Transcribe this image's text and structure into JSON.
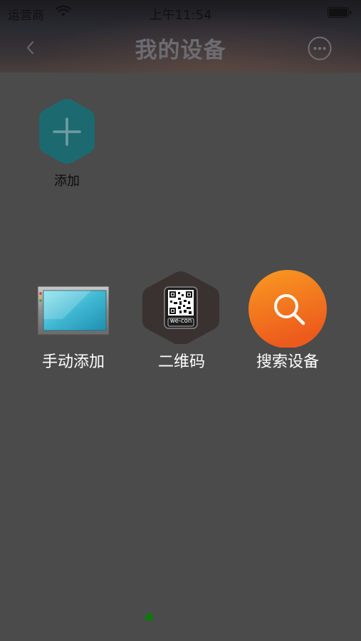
{
  "status_bar": {
    "carrier": "运营商",
    "time": "上午11:54"
  },
  "header": {
    "title": "我的设备",
    "back_icon": "chevron-left-icon",
    "more_icon": "more-circle-icon"
  },
  "add_tile": {
    "label": "添加",
    "icon": "plus-hexagon-icon",
    "color": "#1f6d73"
  },
  "options": [
    {
      "label": "手动添加",
      "icon": "hmi-screen-icon"
    },
    {
      "label": "二维码",
      "icon": "qr-code-icon",
      "brand_text": "we-con"
    },
    {
      "label": "搜索设备",
      "icon": "search-icon",
      "color": "#f07a1a"
    }
  ],
  "pager": {
    "active_color": "#0b7a0b"
  }
}
